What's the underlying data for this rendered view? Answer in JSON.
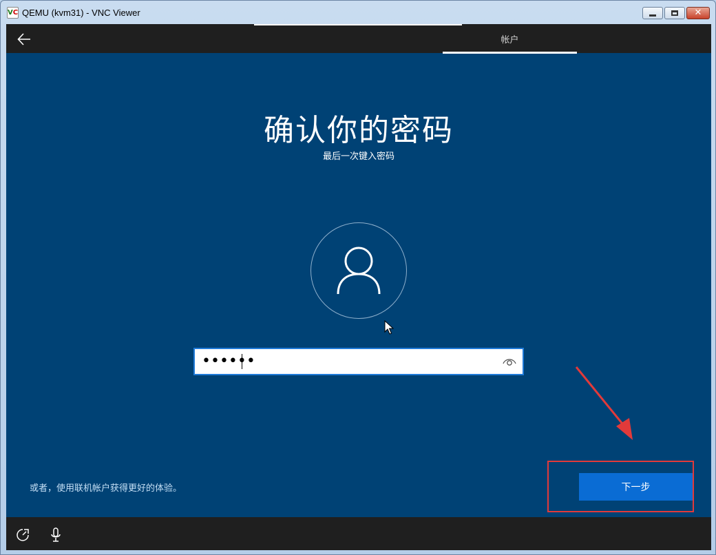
{
  "window": {
    "title": "QEMU (kvm31) - VNC Viewer",
    "icon_text_v": "V",
    "icon_text_c": "C",
    "close_glyph": "✕"
  },
  "header": {
    "tab_label": "帐户"
  },
  "main": {
    "title": "确认你的密码",
    "subtitle": "最后一次键入密码",
    "password_value": "••••••"
  },
  "footer": {
    "online_account_link": "或者，使用联机帐户获得更好的体验。",
    "next_button": "下一步"
  },
  "colors": {
    "background": "#004275",
    "header_bar": "#1f1f1f",
    "next_button": "#0a6cd4",
    "annotation_red": "#e23a3a"
  },
  "icons": [
    "back-arrow-icon",
    "user-icon",
    "eye-icon",
    "ease-of-access-icon",
    "microphone-icon"
  ]
}
